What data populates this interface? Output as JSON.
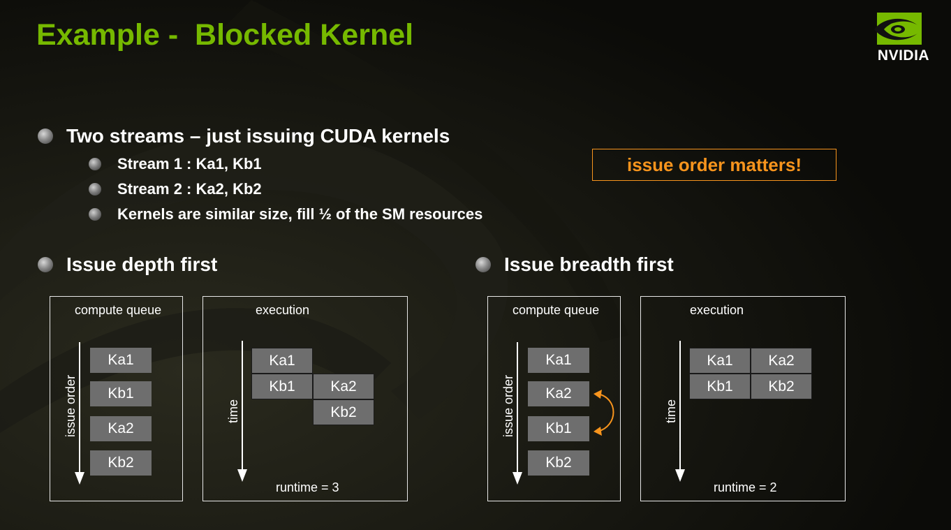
{
  "title": "Example -  Blocked Kernel",
  "logo": {
    "text": "NVIDIA"
  },
  "bullets": {
    "main": "Two streams – just issuing CUDA kernels",
    "sub1": "Stream 1 : Ka1, Kb1",
    "sub2": "Stream 2 : Ka2, Kb2",
    "sub3": "Kernels are similar size, fill ½ of the SM resources"
  },
  "callout": "issue order matters!",
  "left": {
    "heading": "Issue depth first",
    "queue": {
      "label": "compute queue",
      "axis_label": "issue order",
      "items": [
        "Ka1",
        "Kb1",
        "Ka2",
        "Kb2"
      ]
    },
    "execution": {
      "label": "execution",
      "axis_label": "time",
      "kernels": [
        "Ka1",
        "Kb1",
        "Ka2",
        "Kb2"
      ],
      "runtime": "runtime = 3"
    }
  },
  "right": {
    "heading": "Issue breadth first",
    "queue": {
      "label": "compute queue",
      "axis_label": "issue order",
      "items": [
        "Ka1",
        "Ka2",
        "Kb1",
        "Kb2"
      ]
    },
    "execution": {
      "label": "execution",
      "axis_label": "time",
      "kernels": [
        "Ka1",
        "Ka2",
        "Kb1",
        "Kb2"
      ],
      "runtime": "runtime = 2"
    }
  },
  "colors": {
    "title": "#76b900",
    "accent": "#f7941d",
    "kernel_box": "#6e6e6e"
  }
}
